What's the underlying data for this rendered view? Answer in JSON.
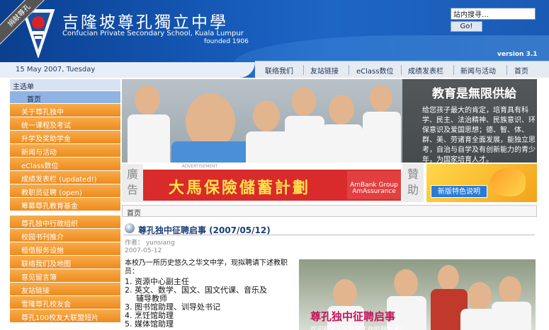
{
  "header": {
    "school_name_cn": "吉隆坡尊孔獨立中學",
    "school_name_en": "Confucian Private Secondary School, Kuala Lumpur",
    "founded": "founded 1906",
    "version": "version 3.1",
    "date": "15 May 2007, Tuesday",
    "search_placeholder": "站内搜寻…",
    "search_value": "站内搜寻…",
    "go_label": "Go!"
  },
  "ribbon": "捐献尊孔",
  "nav": [
    "联络我们",
    "友站链接",
    "eClass数位",
    "成绩发表栏",
    "新闻与活动",
    "首页"
  ],
  "sidebar": {
    "title": "主选单",
    "home": "首页",
    "group1": [
      "关于尊孔独中",
      "统一课程及考试",
      "升学及奖助学金",
      "新闻与活动",
      "eClass数位",
      "成绩发表栏 (updated!)",
      "教职员征聘 (open)",
      "筹募尊孔教育基金"
    ],
    "group2": [
      "尊孔独中行政组织",
      "校园书刊推介",
      "租借服务设施",
      "联络我们及地图",
      "意见留言簿",
      "友站链接",
      "雪隆尊孔校友会",
      "尊孔100校友大联盟短片"
    ]
  },
  "banner": {
    "title": "教育是無限供給",
    "text": "给您孩子最大的肯定，培育具有科学、民主、法治精神、民族意识、环保意识及爱国思想；德、智、体、群、美、劳诸育全面发展，能独立思考，自治与自学及有创新能力的青少年，为国家培育人才。"
  },
  "ad": {
    "left_label": "廣告",
    "tag": "ADVERTISEMENT",
    "main_text": "大馬保險儲蓄計劃",
    "sponsor": "AmBank Group AmAssurance",
    "mid_label": "贊助",
    "button": "新版特色说明"
  },
  "breadcrumb": "首页",
  "article": {
    "title": "尊孔独中征聘启事 (2007/05/12)",
    "author": "作者：  yunsiang",
    "date": "2007-05-12",
    "intro": "本校乃一所历史悠久之华文中学，现拟聘请下述教职员：",
    "items": [
      "1.  资源中心副主任",
      "2.  英文、数学、国文、国文代课、音乐及",
      "辅导教师",
      "3.  图书馆助理、训导处书记",
      "4.  烹饪馆助理",
      "5.  媒体馆助理"
    ],
    "photo_title": "尊孔独中征聘启事",
    "photo_sub": "欢迎有志于从教育工作的朋友来！"
  },
  "colors": {
    "header_blue": "#1456b3",
    "menu_orange": "#f39a2f",
    "title_blue": "#1a3f7a",
    "ad_red": "#d92b2b"
  }
}
